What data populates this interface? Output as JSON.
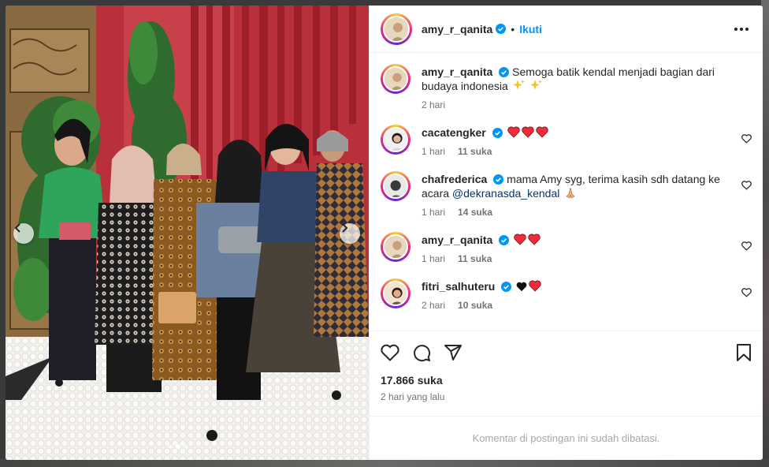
{
  "post": {
    "author": "amy_r_qanita",
    "follow_label": "Ikuti",
    "separator": "•",
    "caption": "Semoga batik kendal menjadi bagian dari budaya indonesia",
    "caption_time": "2 hari",
    "likes": "17.866 suka",
    "posted": "2 hari yang lalu",
    "comments_disabled": "Komentar di postingan ini sudah dibatasi."
  },
  "comments": [
    {
      "user": "cacatengker",
      "text": "",
      "emojis": [
        "red-heart",
        "red-heart",
        "red-heart"
      ],
      "time": "1 hari",
      "likes": "11 suka"
    },
    {
      "user": "chafrederica",
      "text": "mama Amy syg, terima kasih sdh datang ke acara ",
      "mention": "@dekranasda_kendal",
      "emojis": [
        "pray"
      ],
      "time": "1 hari",
      "likes": "14 suka"
    },
    {
      "user": "amy_r_qanita",
      "text": "",
      "emojis": [
        "red-heart",
        "red-heart"
      ],
      "time": "1 hari",
      "likes": "11 suka"
    },
    {
      "user": "fitri_salhuteru",
      "text": "",
      "emojis": [
        "black-heart",
        "red-heart"
      ],
      "time": "2 hari",
      "likes": "10 suka"
    }
  ],
  "colors": {
    "accent": "#0095f6",
    "verified": "#0095f6",
    "heart": "#ed2c3c"
  },
  "icons": [
    "verified-icon",
    "more-icon",
    "heart-icon",
    "comment-icon",
    "share-icon",
    "bookmark-icon",
    "chevron-left-icon",
    "chevron-right-icon",
    "sparkles-icon"
  ]
}
